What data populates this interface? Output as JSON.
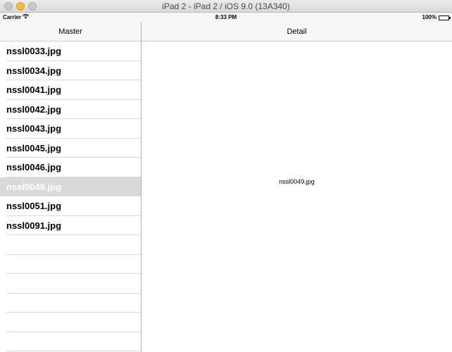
{
  "window": {
    "title": "iPad 2 - iPad 2 / iOS 9.0 (13A340)"
  },
  "status_bar": {
    "carrier": "Carrier",
    "time": "8:33 PM",
    "battery": "100%"
  },
  "master": {
    "title": "Master",
    "items": [
      {
        "label": "nssl0033.jpg",
        "selected": false
      },
      {
        "label": "nssl0034.jpg",
        "selected": false
      },
      {
        "label": "nssl0041.jpg",
        "selected": false
      },
      {
        "label": "nssl0042.jpg",
        "selected": false
      },
      {
        "label": "nssl0043.jpg",
        "selected": false
      },
      {
        "label": "nssl0045.jpg",
        "selected": false
      },
      {
        "label": "nssl0046.jpg",
        "selected": false
      },
      {
        "label": "nssl0049.jpg",
        "selected": true
      },
      {
        "label": "nssl0051.jpg",
        "selected": false
      },
      {
        "label": "nssl0091.jpg",
        "selected": false
      }
    ],
    "empty_rows": 6
  },
  "detail": {
    "title": "Detail",
    "label": "nssl0049.jpg"
  }
}
